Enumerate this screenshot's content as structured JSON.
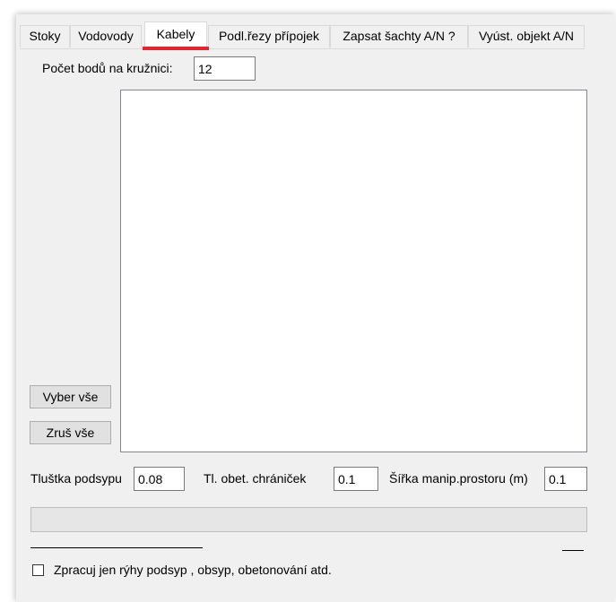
{
  "tabs": [
    {
      "label": "Stoky",
      "active": false
    },
    {
      "label": "Vodovody",
      "active": false
    },
    {
      "label": "Kabely",
      "active": true
    },
    {
      "label": "Podl.řezy přípojek",
      "active": false
    },
    {
      "label": "Zapsat šachty A/N ?",
      "active": false
    },
    {
      "label": "Vyúst. objekt A/N",
      "active": false
    }
  ],
  "points": {
    "label": "Počet bodů na kružnici:",
    "value": "12"
  },
  "buttons": {
    "select_all": "Vyber vše",
    "deselect_all": "Zruš vše"
  },
  "fields": {
    "podsyp": {
      "label": "Tluštka podsypu",
      "value": "0.08"
    },
    "chranicek": {
      "label": "Tl. obet. chrániček",
      "value": "0.1"
    },
    "manip": {
      "label": "Šířka manip.prostoru (m)",
      "value": "0.1"
    }
  },
  "progress": {
    "value": 0
  },
  "checkbox": {
    "label": "Zpracuj jen rýhy podsyp , obsyp, obetonování atd.",
    "checked": false
  },
  "colors": {
    "highlight": "#e6222a",
    "panel": "#f0f0f0"
  }
}
